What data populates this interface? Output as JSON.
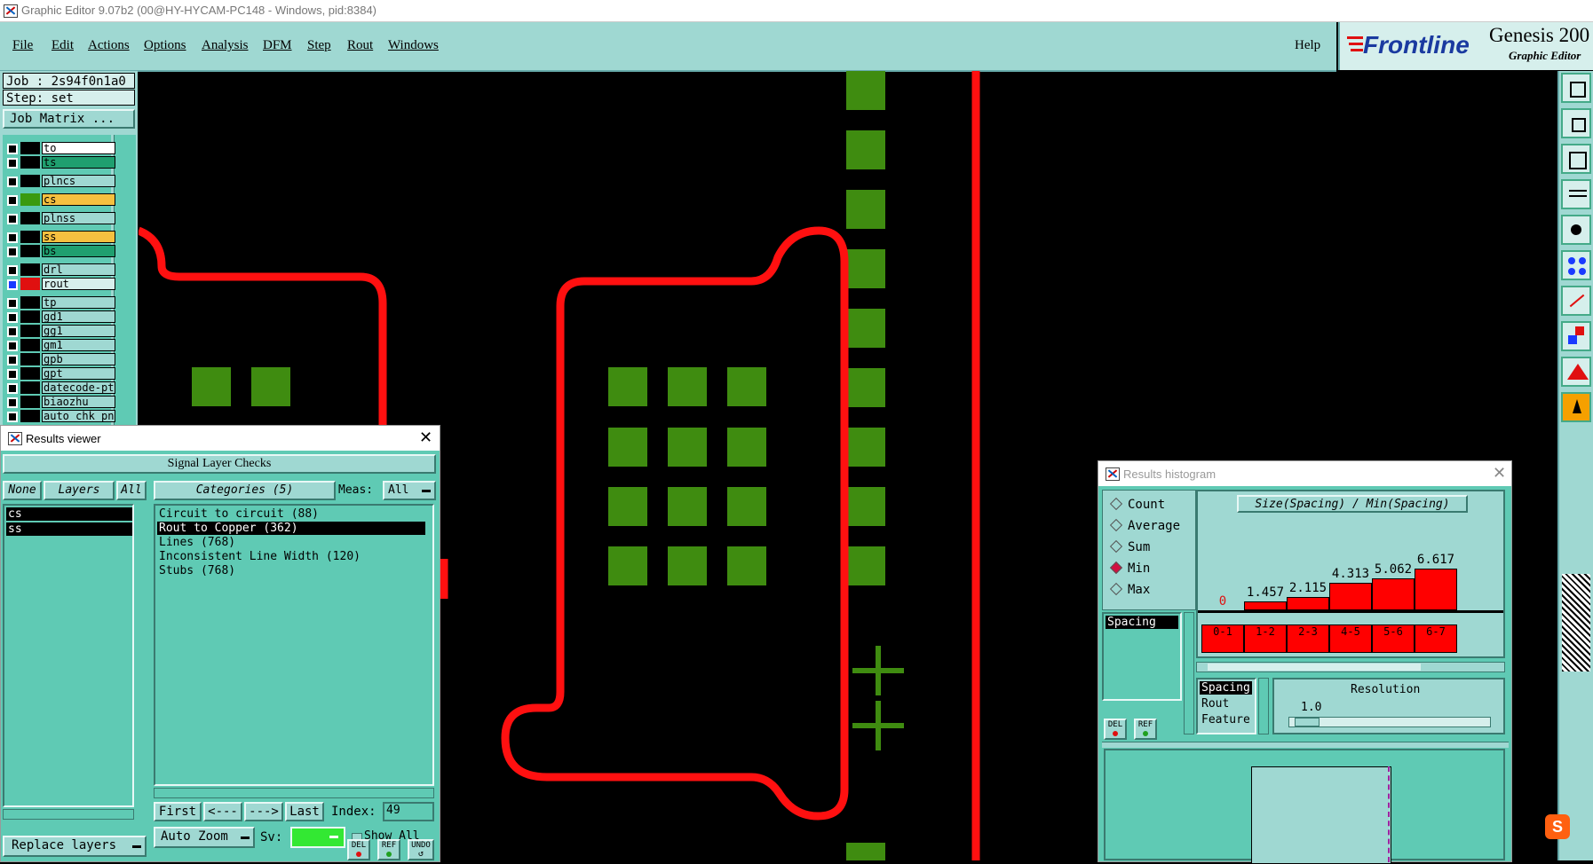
{
  "window": {
    "title": "Graphic Editor 9.07b2 (00@HY-HYCAM-PC148 - Windows, pid:8384)"
  },
  "menu": {
    "items": [
      "File",
      "Edit",
      "Actions",
      "Options",
      "Analysis",
      "DFM",
      "Step",
      "Rout",
      "Windows"
    ],
    "help": "Help"
  },
  "brand": {
    "logo_text": "Frontline",
    "product": "Genesis 200",
    "subtitle": "Graphic Editor"
  },
  "job": {
    "job_label": "Job : 2s94f0n1a0",
    "step_label": "Step: set",
    "matrix_button": "Job Matrix ..."
  },
  "layers": [
    {
      "name": "to",
      "color": "#000000",
      "bg": "#ffffff"
    },
    {
      "name": "ts",
      "color": "#000000",
      "bg": "#1f9f6f"
    },
    {
      "name": "plncs",
      "color": "#000000",
      "bg": "#9fd8d2"
    },
    {
      "name": "cs",
      "color": "#3a9a10",
      "bg": "#f5c040"
    },
    {
      "name": "plnss",
      "color": "#000000",
      "bg": "#9fd8d2"
    },
    {
      "name": "ss",
      "color": "#000000",
      "bg": "#f5c040"
    },
    {
      "name": "bs",
      "color": "#000000",
      "bg": "#1f9f6f"
    },
    {
      "name": "drl",
      "color": "#000000",
      "bg": "#9fd8d2"
    },
    {
      "name": "rout",
      "color": "#e01010",
      "bg": "#d6efec"
    },
    {
      "name": "tp",
      "color": "#000000",
      "bg": "#9fd8d2"
    },
    {
      "name": "gd1",
      "color": "#000000",
      "bg": "#9fd8d2"
    },
    {
      "name": "gg1",
      "color": "#000000",
      "bg": "#9fd8d2"
    },
    {
      "name": "gm1",
      "color": "#000000",
      "bg": "#9fd8d2"
    },
    {
      "name": "gpb",
      "color": "#000000",
      "bg": "#9fd8d2"
    },
    {
      "name": "gpt",
      "color": "#000000",
      "bg": "#9fd8d2"
    },
    {
      "name": "datecode-pt",
      "color": "#000000",
      "bg": "#9fd8d2"
    },
    {
      "name": "biaozhu",
      "color": "#000000",
      "bg": "#9fd8d2"
    },
    {
      "name": "auto_chk_pn",
      "color": "#000000",
      "bg": "#9fd8d2"
    }
  ],
  "results_viewer": {
    "title": "Results viewer",
    "section": "Signal Layer Checks",
    "none_btn": "None",
    "layers_btn": "Layers",
    "all_btn": "All",
    "categories_btn": "Categories (5)",
    "meas_label": "Meas:",
    "meas_value": "All",
    "layer_list": [
      "cs",
      "ss"
    ],
    "categories": [
      "Circuit to circuit (88)",
      "Rout to Copper (362)",
      "Lines (768)",
      "Inconsistent Line Width (120)",
      "Stubs (768)"
    ],
    "selected_category": 1,
    "first": "First",
    "prev": "<---",
    "next": "--->",
    "last": "Last",
    "index_label": "Index:",
    "index_value": "49",
    "auto_zoom": "Auto Zoom",
    "sv_label": "Sv:",
    "show_all": "Show All",
    "replace_layers": "Replace layers",
    "del": "DEL",
    "ref": "REF",
    "undo": "UNDO"
  },
  "histogram": {
    "title": "Results histogram",
    "options": [
      "Count",
      "Average",
      "Sum",
      "Min",
      "Max"
    ],
    "selected_option": "Min",
    "list_item": "Spacing",
    "chart_title": "Size(Spacing) / Min(Spacing)",
    "resolution_label": "Resolution",
    "resolution_value": "1.0",
    "props": [
      "Spacing",
      "Rout",
      "Feature"
    ],
    "del": "DEL",
    "ref": "REF"
  },
  "chart_data": {
    "type": "bar",
    "title": "Size(Spacing) / Min(Spacing)",
    "categories": [
      "0-1",
      "1-2",
      "2-3",
      "4-5",
      "5-6",
      "6-7"
    ],
    "values": [
      0,
      1.457,
      2.115,
      4.313,
      5.062,
      6.617
    ],
    "value_labels": [
      "0",
      "1.457",
      "2.115",
      "4.313",
      "5.062",
      "6.617"
    ],
    "ylim": [
      0,
      7
    ]
  },
  "colors": {
    "panel": "#9fd8d2",
    "panel_dark": "#5fcab4",
    "rout": "#ff1010",
    "pad": "#3f8c10"
  }
}
